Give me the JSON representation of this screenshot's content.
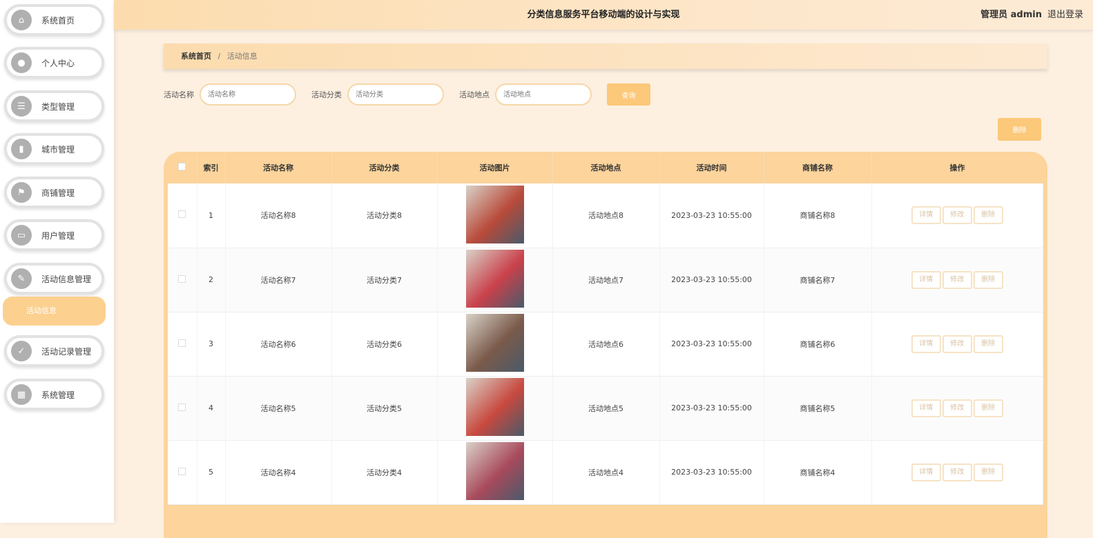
{
  "header": {
    "title": "分类信息服务平台移动端的设计与实现",
    "user": "管理员 admin",
    "logout": "退出登录"
  },
  "sidebar": {
    "items": [
      {
        "label": "系统首页",
        "icon": "⌂"
      },
      {
        "label": "个人中心",
        "icon": "●"
      },
      {
        "label": "类型管理",
        "icon": "☰"
      },
      {
        "label": "城市管理",
        "icon": "▮"
      },
      {
        "label": "商铺管理",
        "icon": "⚑"
      },
      {
        "label": "用户管理",
        "icon": "▭"
      },
      {
        "label": "活动信息管理",
        "icon": "✎"
      },
      {
        "label": "活动记录管理",
        "icon": "✓"
      },
      {
        "label": "系统管理",
        "icon": "▦"
      }
    ],
    "active_sub": "活动信息"
  },
  "breadcrumb": {
    "home": "系统首页",
    "sep": "/",
    "current": "活动信息"
  },
  "search": {
    "name_label": "活动名称",
    "name_placeholder": "活动名称",
    "cat_label": "活动分类",
    "cat_placeholder": "活动分类",
    "place_label": "活动地点",
    "place_placeholder": "活动地点",
    "query": "查询"
  },
  "delete_button": "删除",
  "table": {
    "headers": [
      "索引",
      "活动名称",
      "活动分类",
      "活动图片",
      "活动地点",
      "活动时间",
      "商铺名称",
      "操作"
    ],
    "actions": {
      "detail": "详情",
      "edit": "修改",
      "delete": "删除"
    },
    "rows": [
      {
        "idx": "1",
        "name": "活动名称8",
        "cat": "活动分类8",
        "place": "活动地点8",
        "time": "2023-03-23 10:55:00",
        "shop": "商铺名称8",
        "color": "#b84a3a"
      },
      {
        "idx": "2",
        "name": "活动名称7",
        "cat": "活动分类7",
        "place": "活动地点7",
        "time": "2023-03-23 10:55:00",
        "shop": "商铺名称7",
        "color": "#c9414b"
      },
      {
        "idx": "3",
        "name": "活动名称6",
        "cat": "活动分类6",
        "place": "活动地点6",
        "time": "2023-03-23 10:55:00",
        "shop": "商铺名称6",
        "color": "#7a5a4a"
      },
      {
        "idx": "4",
        "name": "活动名称5",
        "cat": "活动分类5",
        "place": "活动地点5",
        "time": "2023-03-23 10:55:00",
        "shop": "商铺名称5",
        "color": "#c8493f"
      },
      {
        "idx": "5",
        "name": "活动名称4",
        "cat": "活动分类4",
        "place": "活动地点4",
        "time": "2023-03-23 10:55:00",
        "shop": "商铺名称4",
        "color": "#a84a5c"
      }
    ]
  }
}
